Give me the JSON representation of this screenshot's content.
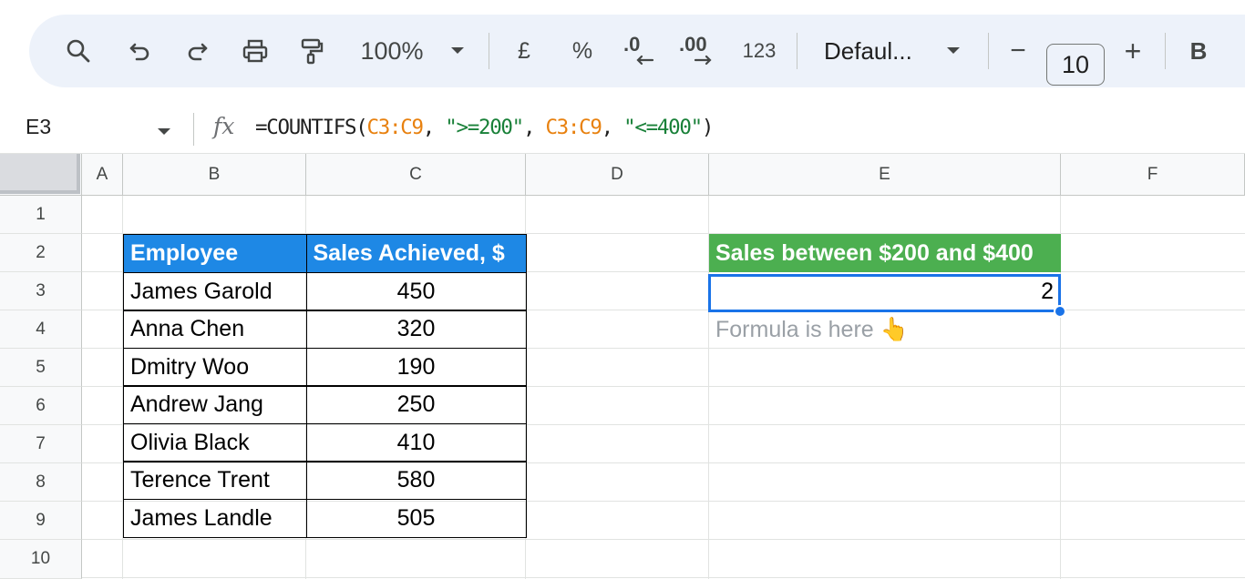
{
  "toolbar": {
    "zoom": "100%",
    "currency": "£",
    "percent": "%",
    "decrease_decimal": ".0",
    "increase_decimal": ".00",
    "number_format": "123",
    "font": "Defaul...",
    "minus": "−",
    "font_size": "10",
    "plus": "+",
    "bold": "B"
  },
  "formula_bar": {
    "name_box": "E3",
    "fx": "fx",
    "formula_parts": [
      "=COUNTIFS(",
      "C3:C9",
      ", ",
      "\">=200\"",
      ", ",
      "C3:C9",
      ", ",
      "\"<=400\"",
      ")"
    ]
  },
  "columns": [
    "A",
    "B",
    "C",
    "D",
    "E",
    "F"
  ],
  "rows": [
    "1",
    "2",
    "3",
    "4",
    "5",
    "6",
    "7",
    "8",
    "9",
    "10"
  ],
  "table": {
    "headers": [
      "Employee",
      "Sales Achieved, $"
    ],
    "rows": [
      [
        "James Garold",
        "450"
      ],
      [
        "Anna Chen",
        "320"
      ],
      [
        "Dmitry Woo",
        "190"
      ],
      [
        "Andrew Jang",
        "250"
      ],
      [
        "Olivia Black",
        "410"
      ],
      [
        "Terence Trent",
        "580"
      ],
      [
        "James Landle",
        "505"
      ]
    ]
  },
  "result": {
    "header": "Sales between $200 and $400",
    "value": "2",
    "note": "Formula is here 👆"
  },
  "colors": {
    "table_header": "#1e88e5",
    "result_header": "#4caf50",
    "selection": "#1a73e8",
    "formula_range": "#e8810f",
    "formula_string": "#188038"
  }
}
